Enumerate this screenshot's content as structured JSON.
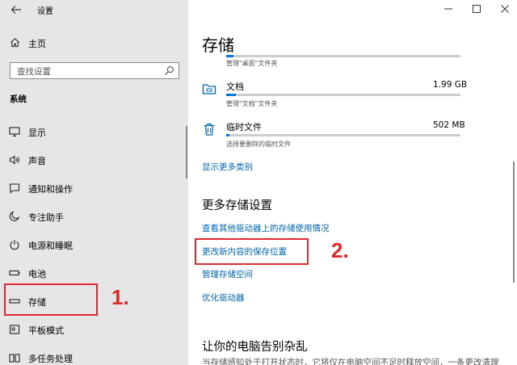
{
  "app": {
    "title": "设置"
  },
  "sidebar": {
    "home_label": "主页",
    "search_placeholder": "查找设置",
    "section_title": "系统",
    "items": [
      {
        "label": "显示",
        "icon": "monitor-icon"
      },
      {
        "label": "声音",
        "icon": "speaker-icon"
      },
      {
        "label": "通知和操作",
        "icon": "notification-icon"
      },
      {
        "label": "专注助手",
        "icon": "moon-icon"
      },
      {
        "label": "电源和睡眠",
        "icon": "power-icon"
      },
      {
        "label": "电池",
        "icon": "battery-icon"
      },
      {
        "label": "存储",
        "icon": "storage-icon",
        "active": true
      },
      {
        "label": "平板模式",
        "icon": "tablet-icon"
      },
      {
        "label": "多任务处理",
        "icon": "multitask-icon"
      }
    ]
  },
  "annotations": {
    "one": "1.",
    "two": "2."
  },
  "main": {
    "title": "存储",
    "top_hint": "管理\"桌面\"文件夹",
    "rows": [
      {
        "name": "文档",
        "size": "1.99 GB",
        "hint": "管理\"文档\"文件夹",
        "icon": "folder-icon",
        "fill": 0.06
      },
      {
        "name": "临时文件",
        "size": "502 MB",
        "hint": "选择要删除的临时文件",
        "icon": "trash-icon",
        "fill": 0.02
      }
    ],
    "show_more": "显示更多类别",
    "more_settings_heading": "更多存储设置",
    "links": [
      "查看其他驱动器上的存储使用情况",
      "更改新内容的保存位置",
      "管理存储空间",
      "优化驱动器"
    ],
    "cleanup_heading": "让你的电脑告别杂乱",
    "cleanup_desc": "当存储感知处于打开状态时，它将仅在电脑空间不足时释放空间，一条更改清理"
  },
  "colors": {
    "accent": "#0078d7",
    "link": "#0066b4",
    "annotation": "#e0282d",
    "sidebar_bg": "#e6e6e6"
  }
}
